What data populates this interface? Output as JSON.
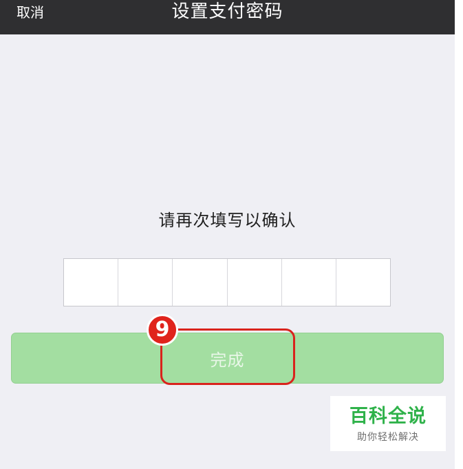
{
  "navbar": {
    "cancel_label": "取消",
    "title": "设置支付密码"
  },
  "main": {
    "prompt": "请再次填写以确认",
    "pin_cells": [
      "",
      "",
      "",
      "",
      "",
      ""
    ],
    "done_label": "完成"
  },
  "annotation": {
    "step_number": "9"
  },
  "watermark": {
    "title": "百科全说",
    "subtitle": "助你轻松解决"
  },
  "colors": {
    "navbar_bg": "#2f2f31",
    "page_bg": "#efeff4",
    "button_bg": "#a3dea1",
    "highlight": "#d9231c",
    "brand_green": "#2fb24a"
  }
}
